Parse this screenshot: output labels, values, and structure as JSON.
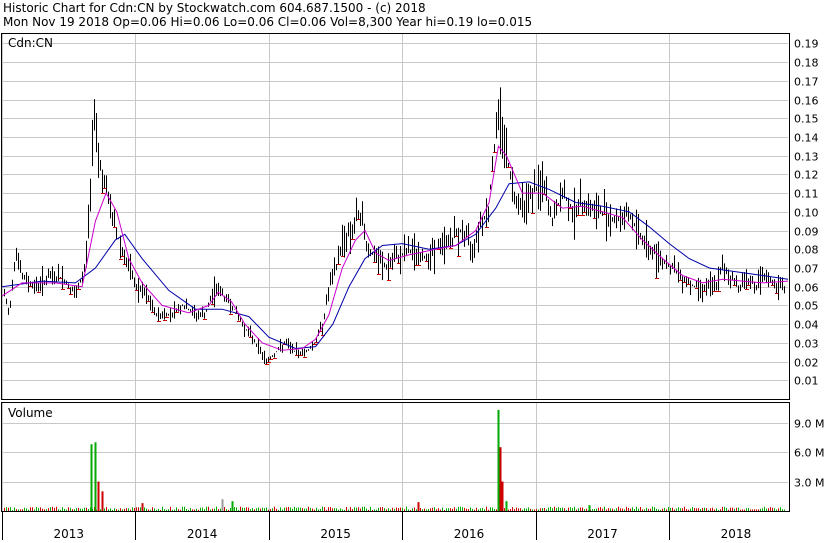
{
  "header": {
    "line1": "Historic Chart for Cdn:CN by Stockwatch.com 604.687.1500 - (c) 2018",
    "line2": "Mon Nov 19 2018  Op=0.06  Hi=0.06  Lo=0.06  Cl=0.06  Vol=8,300  Year hi=0.19  lo=0.015"
  },
  "chart_data": [
    {
      "type": "ohlc",
      "title": "Cdn:CN",
      "ylim": [
        0.0,
        0.195
      ],
      "y_ticks": [
        "0.19",
        "0.18",
        "0.17",
        "0.16",
        "0.15",
        "0.14",
        "0.13",
        "0.12",
        "0.11",
        "0.10",
        "0.09",
        "0.08",
        "0.07",
        "0.06",
        "0.05",
        "0.04",
        "0.03",
        "0.02",
        "0.01"
      ],
      "x_ticks": [
        "2013",
        "2014",
        "2015",
        "2016",
        "2017",
        "2018"
      ],
      "grid": true,
      "x_range": [
        2013.0,
        2018.89
      ],
      "colors": {
        "bar": "#000000",
        "down_tick": "#cc0000",
        "ma_short": "#cc00cc",
        "ma_long": "#0000aa",
        "grid": "#c8c8c8"
      },
      "price": [
        [
          2013.0,
          0.06
        ],
        [
          2013.05,
          0.045
        ],
        [
          2013.1,
          0.08
        ],
        [
          2013.15,
          0.065
        ],
        [
          2013.25,
          0.06
        ],
        [
          2013.35,
          0.065
        ],
        [
          2013.45,
          0.065
        ],
        [
          2013.55,
          0.055
        ],
        [
          2013.62,
          0.07
        ],
        [
          2013.66,
          0.11
        ],
        [
          2013.69,
          0.16
        ],
        [
          2013.72,
          0.13
        ],
        [
          2013.78,
          0.11
        ],
        [
          2013.85,
          0.09
        ],
        [
          2013.92,
          0.075
        ],
        [
          2014.0,
          0.06
        ],
        [
          2014.08,
          0.055
        ],
        [
          2014.15,
          0.045
        ],
        [
          2014.25,
          0.045
        ],
        [
          2014.35,
          0.05
        ],
        [
          2014.45,
          0.045
        ],
        [
          2014.52,
          0.045
        ],
        [
          2014.6,
          0.06
        ],
        [
          2014.66,
          0.055
        ],
        [
          2014.72,
          0.05
        ],
        [
          2014.8,
          0.04
        ],
        [
          2014.9,
          0.03
        ],
        [
          2014.98,
          0.02
        ],
        [
          2015.05,
          0.025
        ],
        [
          2015.12,
          0.03
        ],
        [
          2015.2,
          0.025
        ],
        [
          2015.27,
          0.025
        ],
        [
          2015.34,
          0.03
        ],
        [
          2015.4,
          0.04
        ],
        [
          2015.45,
          0.06
        ],
        [
          2015.5,
          0.07
        ],
        [
          2015.55,
          0.085
        ],
        [
          2015.62,
          0.09
        ],
        [
          2015.68,
          0.1
        ],
        [
          2015.74,
          0.08
        ],
        [
          2015.8,
          0.075
        ],
        [
          2015.88,
          0.07
        ],
        [
          2015.95,
          0.075
        ],
        [
          2016.05,
          0.08
        ],
        [
          2016.15,
          0.075
        ],
        [
          2016.25,
          0.08
        ],
        [
          2016.35,
          0.085
        ],
        [
          2016.45,
          0.09
        ],
        [
          2016.52,
          0.08
        ],
        [
          2016.58,
          0.095
        ],
        [
          2016.64,
          0.1
        ],
        [
          2016.68,
          0.13
        ],
        [
          2016.71,
          0.15
        ],
        [
          2016.74,
          0.15
        ],
        [
          2016.78,
          0.13
        ],
        [
          2016.83,
          0.11
        ],
        [
          2016.9,
          0.105
        ],
        [
          2016.97,
          0.11
        ],
        [
          2017.05,
          0.115
        ],
        [
          2017.12,
          0.095
        ],
        [
          2017.2,
          0.11
        ],
        [
          2017.28,
          0.1
        ],
        [
          2017.36,
          0.105
        ],
        [
          2017.44,
          0.1
        ],
        [
          2017.52,
          0.1
        ],
        [
          2017.6,
          0.095
        ],
        [
          2017.68,
          0.1
        ],
        [
          2017.76,
          0.09
        ],
        [
          2017.85,
          0.08
        ],
        [
          2017.94,
          0.075
        ],
        [
          2018.02,
          0.07
        ],
        [
          2018.1,
          0.065
        ],
        [
          2018.18,
          0.06
        ],
        [
          2018.26,
          0.06
        ],
        [
          2018.34,
          0.06
        ],
        [
          2018.4,
          0.07
        ],
        [
          2018.46,
          0.065
        ],
        [
          2018.52,
          0.06
        ],
        [
          2018.58,
          0.065
        ],
        [
          2018.64,
          0.06
        ],
        [
          2018.72,
          0.065
        ],
        [
          2018.8,
          0.06
        ],
        [
          2018.89,
          0.06
        ]
      ],
      "ma_short": [
        [
          2013.0,
          0.055
        ],
        [
          2013.15,
          0.062
        ],
        [
          2013.4,
          0.062
        ],
        [
          2013.6,
          0.06
        ],
        [
          2013.7,
          0.095
        ],
        [
          2013.78,
          0.11
        ],
        [
          2013.86,
          0.1
        ],
        [
          2013.95,
          0.075
        ],
        [
          2014.05,
          0.062
        ],
        [
          2014.2,
          0.05
        ],
        [
          2014.4,
          0.046
        ],
        [
          2014.55,
          0.05
        ],
        [
          2014.62,
          0.057
        ],
        [
          2014.72,
          0.052
        ],
        [
          2014.82,
          0.04
        ],
        [
          2014.95,
          0.03
        ],
        [
          2015.1,
          0.026
        ],
        [
          2015.25,
          0.027
        ],
        [
          2015.35,
          0.032
        ],
        [
          2015.45,
          0.045
        ],
        [
          2015.55,
          0.07
        ],
        [
          2015.65,
          0.085
        ],
        [
          2015.72,
          0.09
        ],
        [
          2015.8,
          0.078
        ],
        [
          2015.9,
          0.074
        ],
        [
          2016.05,
          0.077
        ],
        [
          2016.25,
          0.08
        ],
        [
          2016.4,
          0.082
        ],
        [
          2016.55,
          0.09
        ],
        [
          2016.65,
          0.105
        ],
        [
          2016.72,
          0.135
        ],
        [
          2016.78,
          0.13
        ],
        [
          2016.9,
          0.11
        ],
        [
          2017.05,
          0.11
        ],
        [
          2017.2,
          0.102
        ],
        [
          2017.35,
          0.103
        ],
        [
          2017.5,
          0.1
        ],
        [
          2017.65,
          0.097
        ],
        [
          2017.8,
          0.085
        ],
        [
          2017.95,
          0.075
        ],
        [
          2018.1,
          0.066
        ],
        [
          2018.25,
          0.062
        ],
        [
          2018.4,
          0.064
        ],
        [
          2018.55,
          0.063
        ],
        [
          2018.7,
          0.062
        ],
        [
          2018.89,
          0.063
        ]
      ],
      "ma_long": [
        [
          2013.0,
          0.06
        ],
        [
          2013.3,
          0.063
        ],
        [
          2013.55,
          0.062
        ],
        [
          2013.7,
          0.07
        ],
        [
          2013.85,
          0.085
        ],
        [
          2013.92,
          0.088
        ],
        [
          2014.05,
          0.075
        ],
        [
          2014.25,
          0.058
        ],
        [
          2014.45,
          0.048
        ],
        [
          2014.65,
          0.048
        ],
        [
          2014.85,
          0.044
        ],
        [
          2015.0,
          0.033
        ],
        [
          2015.2,
          0.027
        ],
        [
          2015.35,
          0.028
        ],
        [
          2015.48,
          0.04
        ],
        [
          2015.6,
          0.06
        ],
        [
          2015.72,
          0.075
        ],
        [
          2015.85,
          0.082
        ],
        [
          2016.0,
          0.083
        ],
        [
          2016.2,
          0.08
        ],
        [
          2016.4,
          0.082
        ],
        [
          2016.55,
          0.088
        ],
        [
          2016.7,
          0.102
        ],
        [
          2016.8,
          0.115
        ],
        [
          2016.95,
          0.116
        ],
        [
          2017.1,
          0.112
        ],
        [
          2017.3,
          0.105
        ],
        [
          2017.5,
          0.103
        ],
        [
          2017.7,
          0.1
        ],
        [
          2017.85,
          0.092
        ],
        [
          2018.0,
          0.083
        ],
        [
          2018.15,
          0.075
        ],
        [
          2018.3,
          0.07
        ],
        [
          2018.5,
          0.068
        ],
        [
          2018.7,
          0.066
        ],
        [
          2018.89,
          0.064
        ]
      ]
    },
    {
      "type": "bar",
      "title": "Volume",
      "ylim": [
        0,
        11.0
      ],
      "y_ticks": [
        "9.0 M",
        "6.0 M",
        "3.0 M"
      ],
      "unit": "M",
      "spikes": [
        {
          "x": 2013.67,
          "value": 6.8,
          "color": "#00aa00"
        },
        {
          "x": 2013.7,
          "value": 7.0,
          "color": "#00aa00"
        },
        {
          "x": 2013.72,
          "value": 3.0,
          "color": "#cc0000"
        },
        {
          "x": 2013.75,
          "value": 2.0,
          "color": "#cc0000"
        },
        {
          "x": 2014.05,
          "value": 0.8,
          "color": "#cc0000"
        },
        {
          "x": 2014.65,
          "value": 1.2,
          "color": "#999999"
        },
        {
          "x": 2014.72,
          "value": 1.0,
          "color": "#00aa00"
        },
        {
          "x": 2016.12,
          "value": 0.9,
          "color": "#cc0000"
        },
        {
          "x": 2016.72,
          "value": 10.3,
          "color": "#00aa00"
        },
        {
          "x": 2016.73,
          "value": 6.5,
          "color": "#cc0000"
        },
        {
          "x": 2016.75,
          "value": 3.0,
          "color": "#cc0000"
        },
        {
          "x": 2016.78,
          "value": 1.0,
          "color": "#00aa00"
        },
        {
          "x": 2017.4,
          "value": 0.6,
          "color": "#00aa00"
        }
      ]
    }
  ]
}
